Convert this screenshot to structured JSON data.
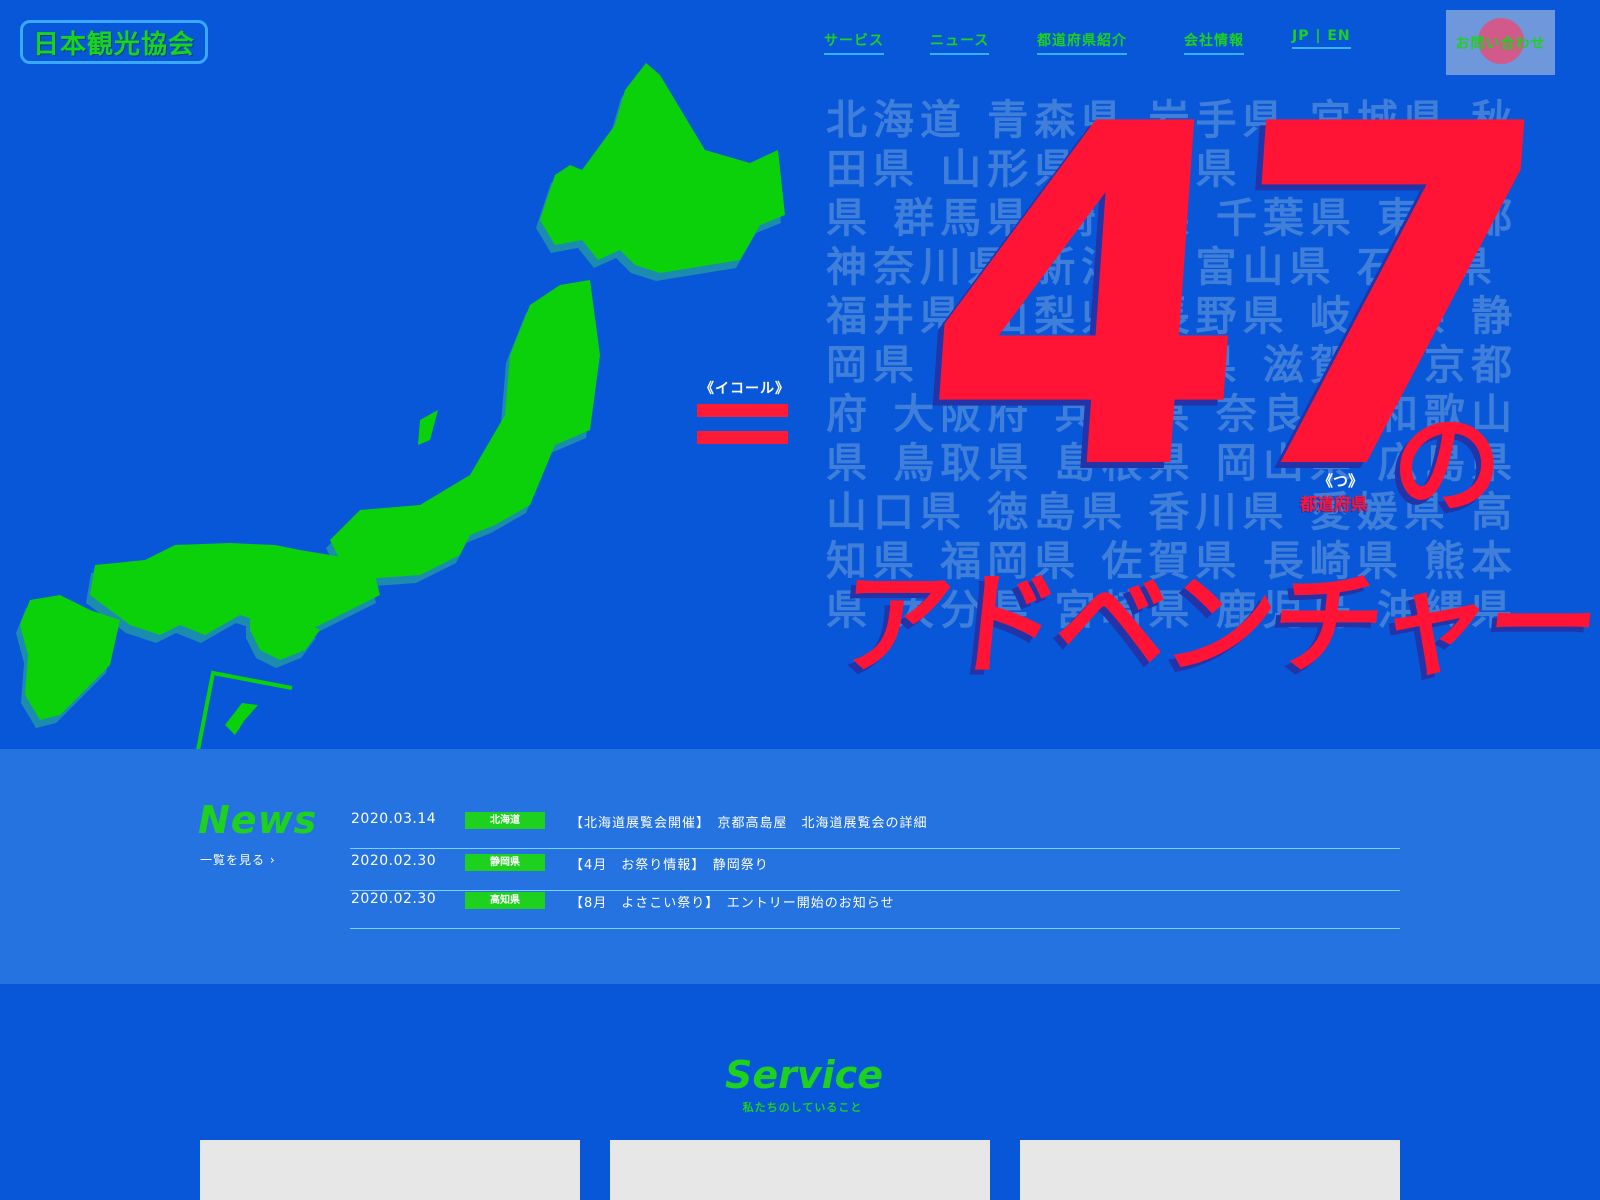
{
  "header": {
    "logo": "日本観光協会",
    "nav": [
      {
        "label": "サービス"
      },
      {
        "label": "ニュース"
      },
      {
        "label": "都道府県紹介"
      },
      {
        "label": "会社情報"
      },
      {
        "label": "JP | EN"
      }
    ],
    "contact_label": "お問い合わせ"
  },
  "hero": {
    "equal_label": "《イコール》",
    "big_number": "47",
    "no": "の",
    "ruby": "《つ》",
    "ruby_base": "都道府県",
    "headline": "アドベンチャー",
    "prefectures_bg": "北海道 青森県 岩手県 宮城県 秋田県 山形県 福島県 茨城県 栃木県 群馬県 埼玉県 千葉県 東京都 神奈川県 新潟県 富山県 石川県 福井県 山梨県 長野県 岐阜県 静岡県 愛知県 三重県 滋賀県 京都府 大阪府 兵庫県 奈良県 和歌山県 鳥取県 島根県 岡山県 広島県 山口県 徳島県 香川県 愛媛県 高知県 福岡県 佐賀県 長崎県 熊本県 大分県 宮崎県 鹿児島 沖縄県",
    "colors": {
      "map": "#19d419",
      "accent": "#ff1436",
      "bg": "#0757d8"
    }
  },
  "news": {
    "title": "News",
    "more": "一覧を見る ›",
    "items": [
      {
        "date": "2020.03.14",
        "tag": "北海道",
        "title": "【北海道展覧会開催】　京都高島屋　北海道展覧会の詳細"
      },
      {
        "date": "2020.02.30",
        "tag": "静岡県",
        "title": "【4月　お祭り情報】　静岡祭り"
      },
      {
        "date": "2020.02.30",
        "tag": "高知県",
        "title": "【8月　よさこい祭り】　エントリー開始のお知らせ"
      }
    ]
  },
  "service": {
    "title": "Service",
    "subtitle": "私たちのしていること"
  }
}
